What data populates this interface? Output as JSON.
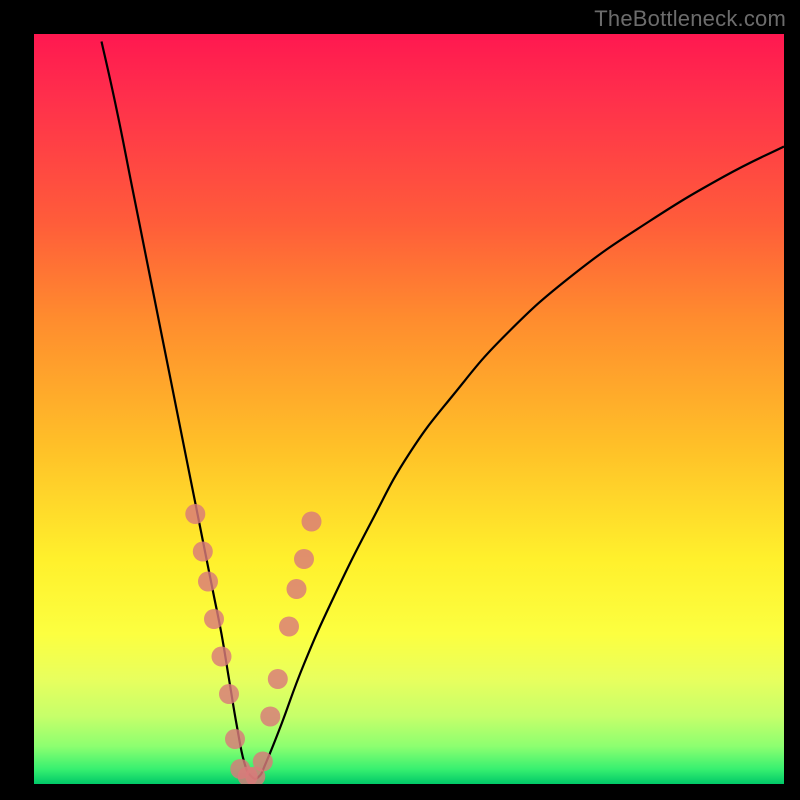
{
  "watermark": "TheBottleneck.com",
  "chart_data": {
    "type": "line",
    "title": "",
    "xlabel": "",
    "ylabel": "",
    "xlim": [
      0,
      100
    ],
    "ylim": [
      0,
      100
    ],
    "grid": false,
    "legend": false,
    "series": [
      {
        "name": "curve",
        "x": [
          9,
          11,
          13,
          15,
          17,
          19,
          21,
          22,
          23,
          24,
          25,
          26,
          27,
          28,
          29,
          30,
          31,
          33,
          36,
          40,
          45,
          50,
          56,
          63,
          72,
          82,
          92,
          100
        ],
        "values": [
          99,
          90,
          80,
          70,
          60,
          50,
          40,
          35,
          30,
          25,
          20,
          14,
          8,
          3,
          1,
          1,
          3,
          8,
          16,
          25,
          35,
          44,
          52,
          60,
          68,
          75,
          81,
          85
        ]
      }
    ],
    "markers": {
      "name": "marker-dots",
      "x": [
        21.5,
        22.5,
        23.2,
        24.0,
        25.0,
        26.0,
        26.8,
        27.5,
        28.5,
        29.5,
        30.5,
        31.5,
        32.5,
        34.0,
        35.0,
        36.0,
        37.0
      ],
      "values": [
        36.0,
        31.0,
        27.0,
        22.0,
        17.0,
        12.0,
        6.0,
        2.0,
        1.0,
        1.0,
        3.0,
        9.0,
        14.0,
        21.0,
        26.0,
        30.0,
        35.0
      ]
    }
  }
}
